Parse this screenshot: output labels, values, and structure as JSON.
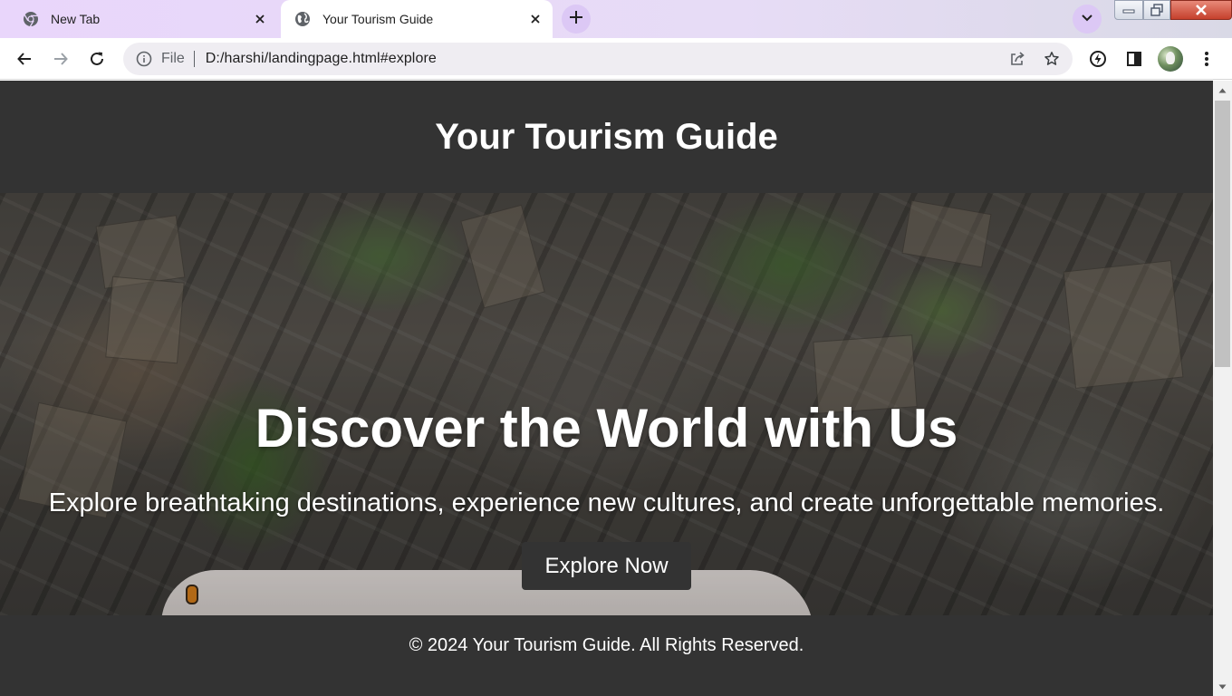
{
  "browser": {
    "tabs": [
      {
        "title": "New Tab",
        "icon": "chrome-icon",
        "active": false
      },
      {
        "title": "Your Tourism Guide",
        "icon": "globe-icon",
        "active": true
      }
    ],
    "omnibox": {
      "scheme_label": "File",
      "url": "D:/harshi/landingpage.html#explore"
    },
    "colors": {
      "tab_strip": "#e9d6fb",
      "new_tab_button": "#dcc8f5",
      "omnibox_bg": "#efedf2"
    }
  },
  "page": {
    "header_title": "Your Tourism Guide",
    "hero": {
      "heading": "Discover the World with Us",
      "subheading": "Explore breathtaking destinations, experience new cultures, and create unforgettable memories.",
      "cta_label": "Explore Now"
    },
    "footer_text": "© 2024 Your Tourism Guide. All Rights Reserved.",
    "colors": {
      "header_bg": "#333333",
      "button_bg": "#333333",
      "text": "#ffffff"
    }
  }
}
